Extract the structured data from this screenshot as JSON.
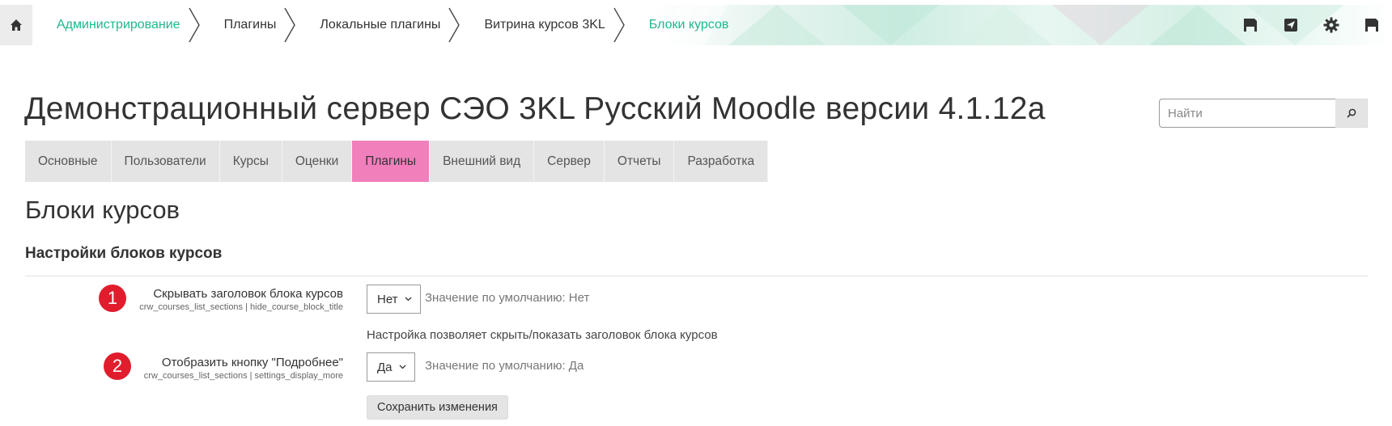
{
  "breadcrumb": {
    "items": [
      {
        "label": "Администрирование",
        "link": true
      },
      {
        "label": "Плагины",
        "link": false
      },
      {
        "label": "Локальные плагины",
        "link": false
      },
      {
        "label": "Витрина курсов 3KL",
        "link": false
      },
      {
        "label": "Блоки курсов",
        "link": true
      }
    ]
  },
  "top_icons": [
    "home-icon",
    "save-icon",
    "send-icon",
    "gear-icon",
    "save-icon"
  ],
  "header": {
    "site_title": "Демонстрационный сервер СЭО 3KL Русский Moodle версии 4.1.12a"
  },
  "search": {
    "placeholder": "Найти",
    "icon": "search-icon"
  },
  "tabs": [
    {
      "label": "Основные",
      "active": false
    },
    {
      "label": "Пользователи",
      "active": false
    },
    {
      "label": "Курсы",
      "active": false
    },
    {
      "label": "Оценки",
      "active": false
    },
    {
      "label": "Плагины",
      "active": true
    },
    {
      "label": "Внешний вид",
      "active": false
    },
    {
      "label": "Сервер",
      "active": false
    },
    {
      "label": "Отчеты",
      "active": false
    },
    {
      "label": "Разработка",
      "active": false
    }
  ],
  "page": {
    "heading": "Блоки курсов",
    "section_heading": "Настройки блоков курсов"
  },
  "settings": [
    {
      "badge": "1",
      "label": "Скрывать заголовок блока курсов",
      "key": "crw_courses_list_sections | hide_course_block_title",
      "value": "Нет",
      "default": "Значение по умолчанию: Нет",
      "description": "Настройка позволяет скрыть/показать заголовок блока курсов"
    },
    {
      "badge": "2",
      "label": "Отобразить кнопку \"Подробнее\"",
      "key": "crw_courses_list_sections | settings_display_more",
      "value": "Да",
      "default": "Значение по умолчанию: Да"
    }
  ],
  "save_button": "Сохранить изменения",
  "colors": {
    "accent_link": "#1db88e",
    "active_tab": "#f07fbc",
    "badge": "#e11d2d"
  }
}
